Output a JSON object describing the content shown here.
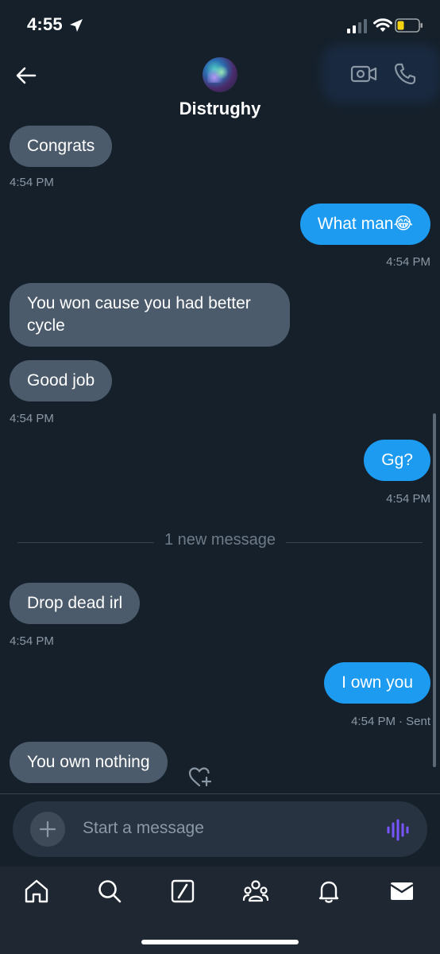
{
  "status_bar": {
    "time": "4:55"
  },
  "header": {
    "title": "Distrughy"
  },
  "messages": [
    {
      "text": "Congrats",
      "time": "4:54 PM"
    },
    {
      "text": "What man😂",
      "time": "4:54 PM"
    },
    {
      "text": "You won cause you had better cycle"
    },
    {
      "text": "Good job",
      "time": "4:54 PM"
    },
    {
      "text": "Gg?",
      "time": "4:54 PM"
    },
    {
      "text": "Drop dead irl",
      "time": "4:54 PM"
    },
    {
      "text": "I own you",
      "time": "4:54 PM",
      "status": "· Sent"
    },
    {
      "text": "You own nothing"
    }
  ],
  "divider": {
    "label": "1 new message"
  },
  "composer": {
    "placeholder": "Start a message"
  },
  "colors": {
    "background": "#15202b",
    "incoming_bubble": "#4b5b6b",
    "outgoing_bubble": "#1d9bf0",
    "voice_accent": "#7856ff"
  },
  "icons": {
    "status": [
      "location-arrow-icon",
      "signal-icon",
      "wifi-icon",
      "battery-icon"
    ],
    "header": [
      "back-arrow-icon",
      "video-call-icon",
      "phone-call-icon"
    ],
    "nav": [
      "home-icon",
      "search-icon",
      "grok-icon",
      "communities-icon",
      "notifications-icon",
      "messages-icon"
    ]
  }
}
